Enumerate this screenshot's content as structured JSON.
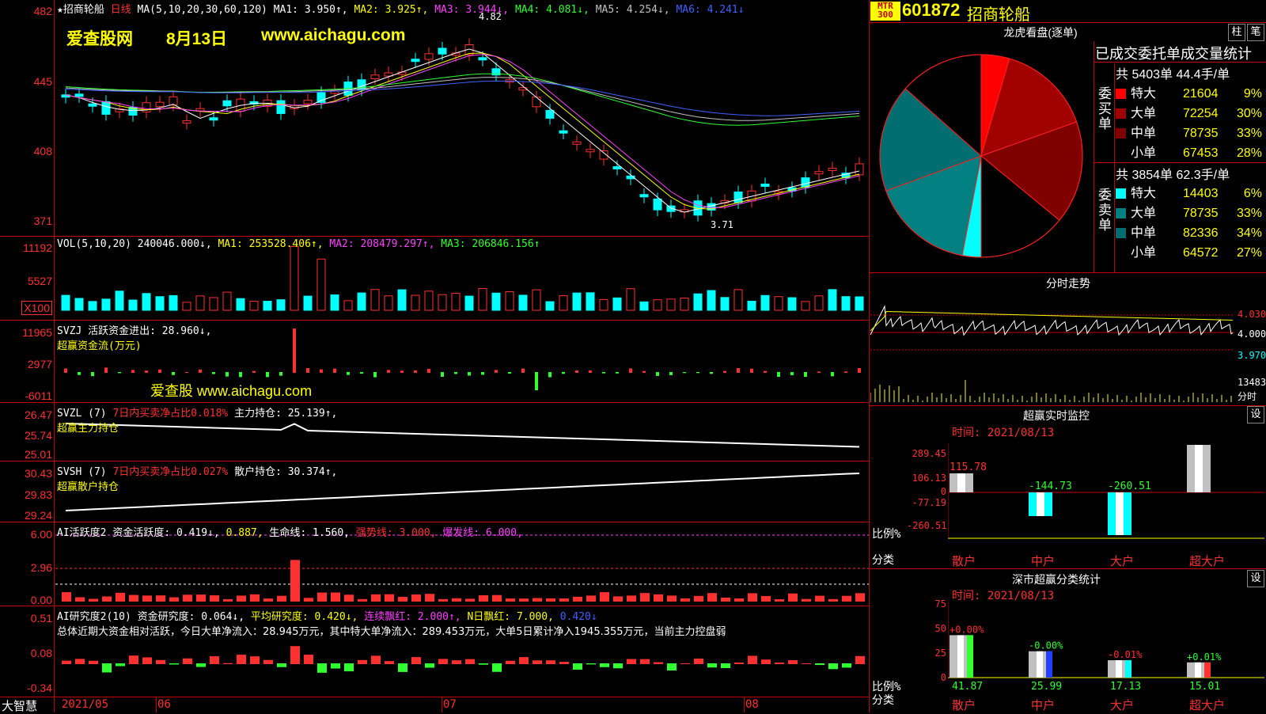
{
  "header": {
    "title_line": "★招商轮船",
    "period": "日线",
    "ma_label": "MA(5,10,20,30,60,120)",
    "ma1": "MA1: 3.950↑,",
    "ma2": "MA2: 3.925↑,",
    "ma3": "MA3: 3.944↓,",
    "ma4": "MA4: 4.081↓,",
    "ma5": "MA5: 4.254↓,",
    "ma6": "MA6: 4.241↓"
  },
  "watermark": {
    "site": "爱查股网",
    "date": "8月13日",
    "url": "www.aichagu.com",
    "url2": "爱查股 www.aichagu.com"
  },
  "price_axis": [
    "482",
    "445",
    "408",
    "371"
  ],
  "price_marks": {
    "high": "4.82",
    "low": "3.71"
  },
  "vol": {
    "legend": "VOL(5,10,20)",
    "value": "240046.000↓,",
    "ma1": "MA1: 253528.406↑,",
    "ma2": "MA2: 208479.297↑,",
    "ma3": "MA3: 206846.156↑",
    "axis": [
      "11192",
      "5527",
      "X100"
    ]
  },
  "svzj": {
    "legend": "SVZJ  活跃资金进出: 28.960↓,",
    "sub": "超赢资金流(万元)",
    "axis": [
      "11965",
      "2977",
      "-6011"
    ]
  },
  "svzl": {
    "legend_a": "SVZL (7)",
    "legend_b": "7日内买卖净占比0.018%",
    "legend_c": "主力持仓: 25.139↑,",
    "sub": "超赢主力持仓",
    "axis": [
      "26.47",
      "25.74",
      "25.01"
    ]
  },
  "svsh": {
    "legend_a": "SVSH (7)",
    "legend_b": "7日内买卖净占比0.027%",
    "legend_c": "散户持仓: 30.374↑,",
    "sub": "超赢散户持仓",
    "axis": [
      "30.43",
      "29.83",
      "29.24"
    ]
  },
  "ai1": {
    "legend_a": "AI活跃度2",
    "legend_b": "资金活跃度: 0.419↓,",
    "legend_c": "0.887,",
    "legend_d": "生命线: 1.560,",
    "legend_e": "强势线: 3.000,",
    "legend_f": "爆发线: 6.000,",
    "axis": [
      "6.00",
      "2.96",
      "0.00"
    ]
  },
  "ai2": {
    "legend_a": "AI研究度2(10)",
    "legend_b": "资金研究度: 0.064↓,",
    "legend_c": "平均研究度: 0.420↓,",
    "legend_d": "连续飘红: 2.000↑,",
    "legend_e": "N日飘红: 7.000,",
    "legend_f": "0.420↓",
    "summary": "总体近期大资金相对活跃，今日大单净流入：28.945万元，其中特大单净流入：289.453万元，大单5日累计净入1945.355万元，当前主力控盘弱",
    "axis": [
      "0.51",
      "0.08",
      "-0.34"
    ]
  },
  "x_axis": {
    "brand": "大智慧",
    "labels": [
      "2021/05",
      "06",
      "07",
      "08"
    ]
  },
  "right": {
    "badge": "MTR 300",
    "code": "601872",
    "name": "招商轮船",
    "lhb_title": "龙虎看盘(逐单)",
    "btn_zhu": "柱",
    "btn_bi": "笔",
    "table_title": "已成交委托单成交量统计",
    "buy_side": "委买单",
    "sell_side": "委卖单",
    "buy_total": "共 5403单 44.4手/单",
    "sell_total": "共 3854单 62.3手/单",
    "buy_rows": [
      {
        "label": "特大",
        "value": "21604",
        "pct": "9%",
        "color": "#ff0000"
      },
      {
        "label": "大单",
        "value": "72254",
        "pct": "30%",
        "color": "#a00000"
      },
      {
        "label": "中单",
        "value": "78735",
        "pct": "33%",
        "color": "#800000"
      },
      {
        "label": "小单",
        "value": "67453",
        "pct": "28%",
        "color": "#000000"
      }
    ],
    "sell_rows": [
      {
        "label": "特大",
        "value": "14403",
        "pct": "6%",
        "color": "#00ffff"
      },
      {
        "label": "大单",
        "value": "78735",
        "pct": "33%",
        "color": "#008080"
      },
      {
        "label": "中单",
        "value": "82336",
        "pct": "34%",
        "color": "#006d70"
      },
      {
        "label": "小单",
        "value": "64572",
        "pct": "27%",
        "color": "#000000"
      }
    ],
    "fenshi_title": "分时走势",
    "fenshi_axis": [
      "4.030",
      "4.000",
      "3.970"
    ],
    "fenshi_vol": [
      "13483",
      "分时"
    ],
    "monitor_title": "超赢实时监控",
    "monitor_btn": "设",
    "monitor_time": "时间: 2021/08/13",
    "monitor_axis": [
      "289.45",
      "106.13",
      "0",
      "-77.19",
      "-260.51"
    ],
    "monitor_labels_left": [
      "比例%",
      "分类"
    ],
    "monitor_bars": [
      {
        "cat": "散户",
        "value": "115.78"
      },
      {
        "cat": "中户",
        "value": "-144.73"
      },
      {
        "cat": "大户",
        "value": "-260.51"
      },
      {
        "cat": "超大户",
        "value": "289.45"
      }
    ],
    "stat_title": "深市超赢分类统计",
    "stat_btn": "设",
    "stat_time": "时间: 2021/08/13",
    "stat_axis": [
      "75",
      "50",
      "25",
      "0"
    ],
    "stat_labels_left": [
      "比例%",
      "分类"
    ],
    "stat_bars": [
      {
        "cat": "散户",
        "top": "+0.00%",
        "bottom": "41.87"
      },
      {
        "cat": "中户",
        "top": "-0.00%",
        "bottom": "25.99"
      },
      {
        "cat": "大户",
        "top": "-0.01%",
        "bottom": "17.13"
      },
      {
        "cat": "超大户",
        "top": "+0.01%",
        "bottom": "15.01"
      }
    ]
  }
}
